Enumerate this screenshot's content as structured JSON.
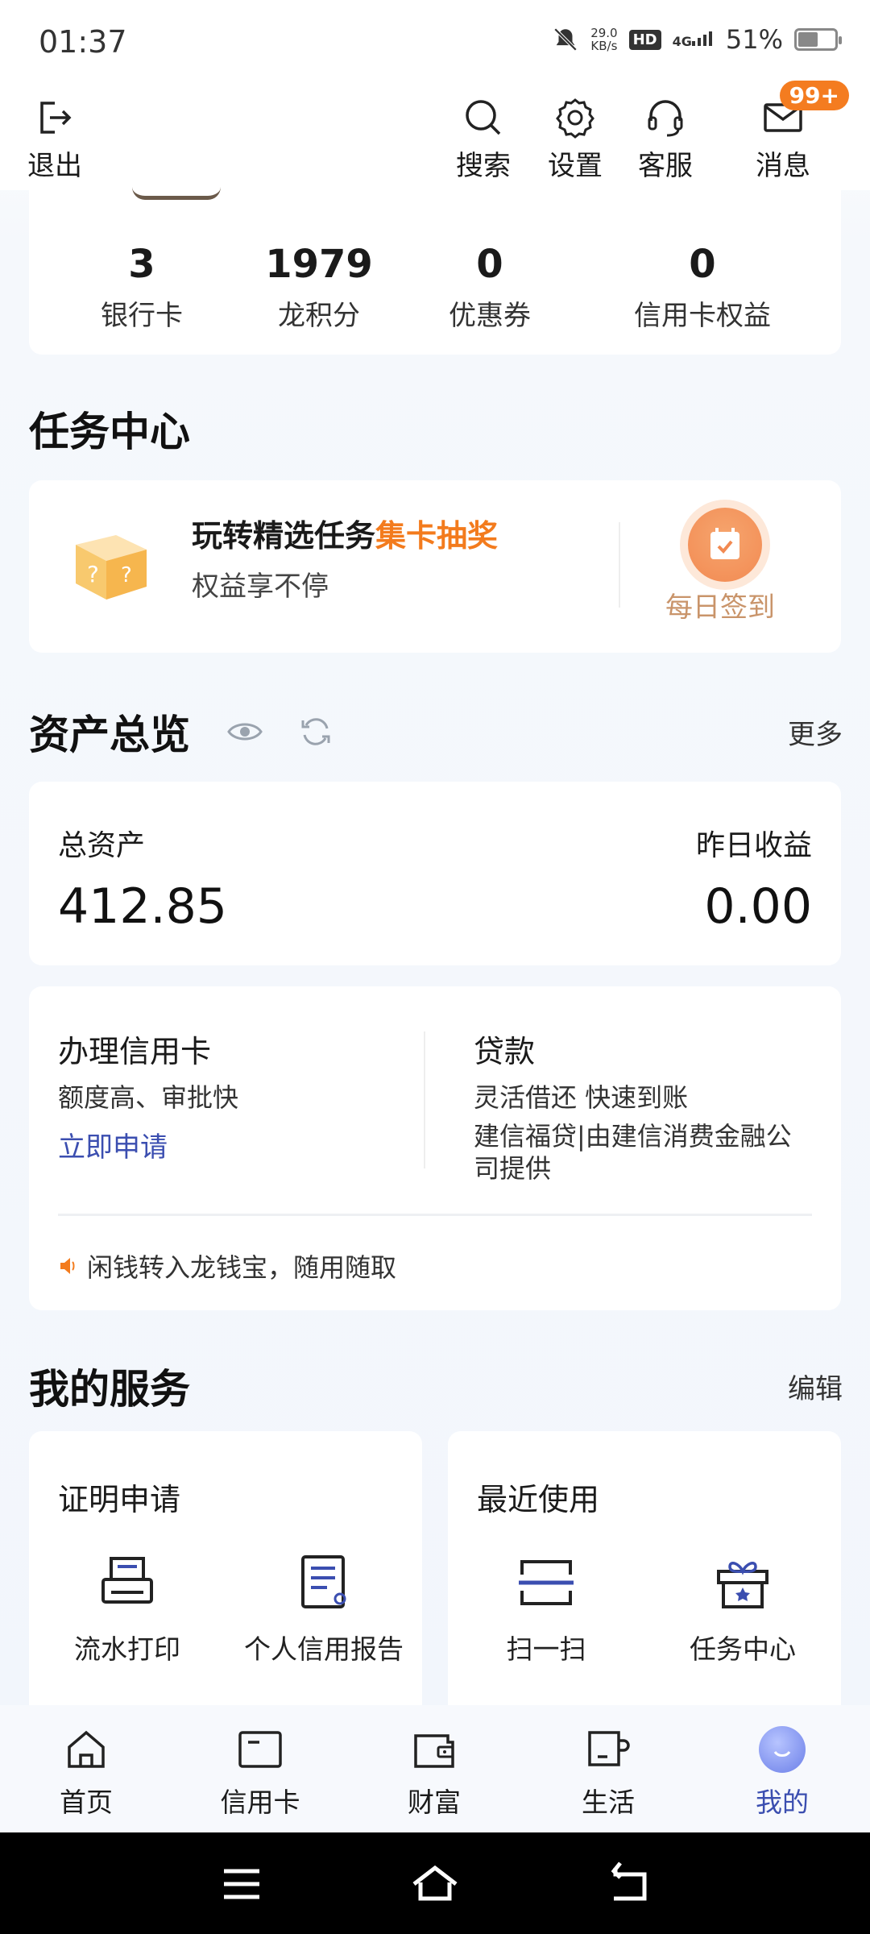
{
  "status_bar": {
    "time": "01:37",
    "net_speed_value": "29.0",
    "net_speed_unit": "KB/s",
    "hd": "HD",
    "signal": "4G",
    "battery": "51%"
  },
  "top_nav": {
    "logout": "退出",
    "search": "搜索",
    "settings": "设置",
    "service": "客服",
    "messages": "消息",
    "messages_badge": "99+"
  },
  "stats": [
    {
      "value": "3",
      "label": "银行卡"
    },
    {
      "value": "1979",
      "label": "龙积分"
    },
    {
      "value": "0",
      "label": "优惠券"
    },
    {
      "value": "0",
      "label": "信用卡权益"
    }
  ],
  "task_center": {
    "title": "任务中心",
    "headline_prefix": "玩转精选任务",
    "headline_highlight": "集卡抽奖",
    "subtitle": "权益享不停",
    "signin_label": "每日签到"
  },
  "assets": {
    "title": "资产总览",
    "more": "更多",
    "total_label": "总资产",
    "total_value": "412.85",
    "yesterday_label": "昨日收益",
    "yesterday_value": "0.00"
  },
  "offers": {
    "credit_card": {
      "title": "办理信用卡",
      "desc": "额度高、审批快",
      "link": "立即申请"
    },
    "loan": {
      "title": "贷款",
      "desc": "灵活借还 快速到账",
      "provider_line1": "建信福贷|由建信消费金融公",
      "provider_line2": "司提供"
    },
    "notice": "闲钱转入龙钱宝，随用随取"
  },
  "services": {
    "title": "我的服务",
    "edit": "编辑",
    "certificate": {
      "title": "证明申请",
      "items": [
        "流水打印",
        "个人信用报告"
      ]
    },
    "recent": {
      "title": "最近使用",
      "items": [
        "扫一扫",
        "任务中心"
      ]
    }
  },
  "tabbar": {
    "items": [
      "首页",
      "信用卡",
      "财富",
      "生活",
      "我的"
    ],
    "active": "我的",
    "active_color": "#3b4eb0"
  },
  "colors": {
    "highlight_orange": "#f37b1d",
    "badge_orange": "#f47c20",
    "link_blue": "#3b4eb0"
  }
}
